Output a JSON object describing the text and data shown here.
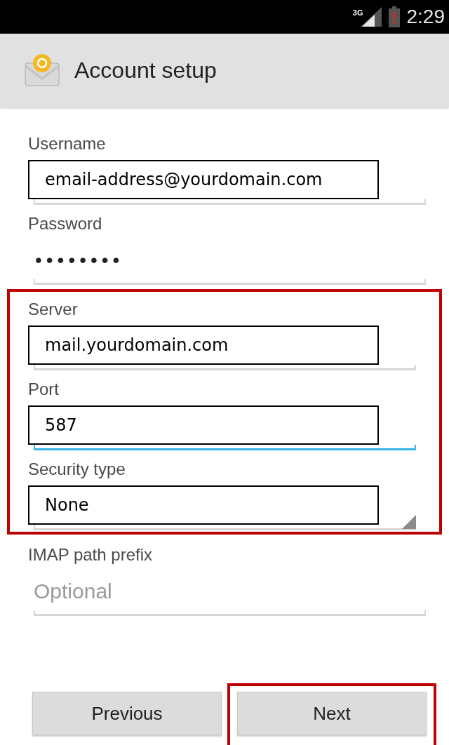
{
  "status_bar": {
    "network": "3G",
    "time": "2:29"
  },
  "action_bar": {
    "title": "Account setup"
  },
  "fields": [
    {
      "label": "Username",
      "kind": "text",
      "value": "email-address@yourdomain.com",
      "focused": false,
      "highlighted": false
    },
    {
      "label": "Password",
      "kind": "password",
      "value": "••••••••",
      "focused": false,
      "highlighted": false
    },
    {
      "label": "Server",
      "kind": "text",
      "value": "mail.yourdomain.com",
      "focused": false,
      "highlighted": true
    },
    {
      "label": "Port",
      "kind": "text",
      "value": "587",
      "focused": true,
      "highlighted": true
    },
    {
      "label": "Security type",
      "kind": "select",
      "value": "None",
      "focused": false,
      "highlighted": true
    },
    {
      "label": "IMAP path prefix",
      "kind": "text",
      "placeholder": "Optional",
      "focused": false,
      "highlighted": false
    }
  ],
  "buttons": [
    {
      "label": "Previous",
      "highlighted": false
    },
    {
      "label": "Next",
      "highlighted": true
    }
  ]
}
